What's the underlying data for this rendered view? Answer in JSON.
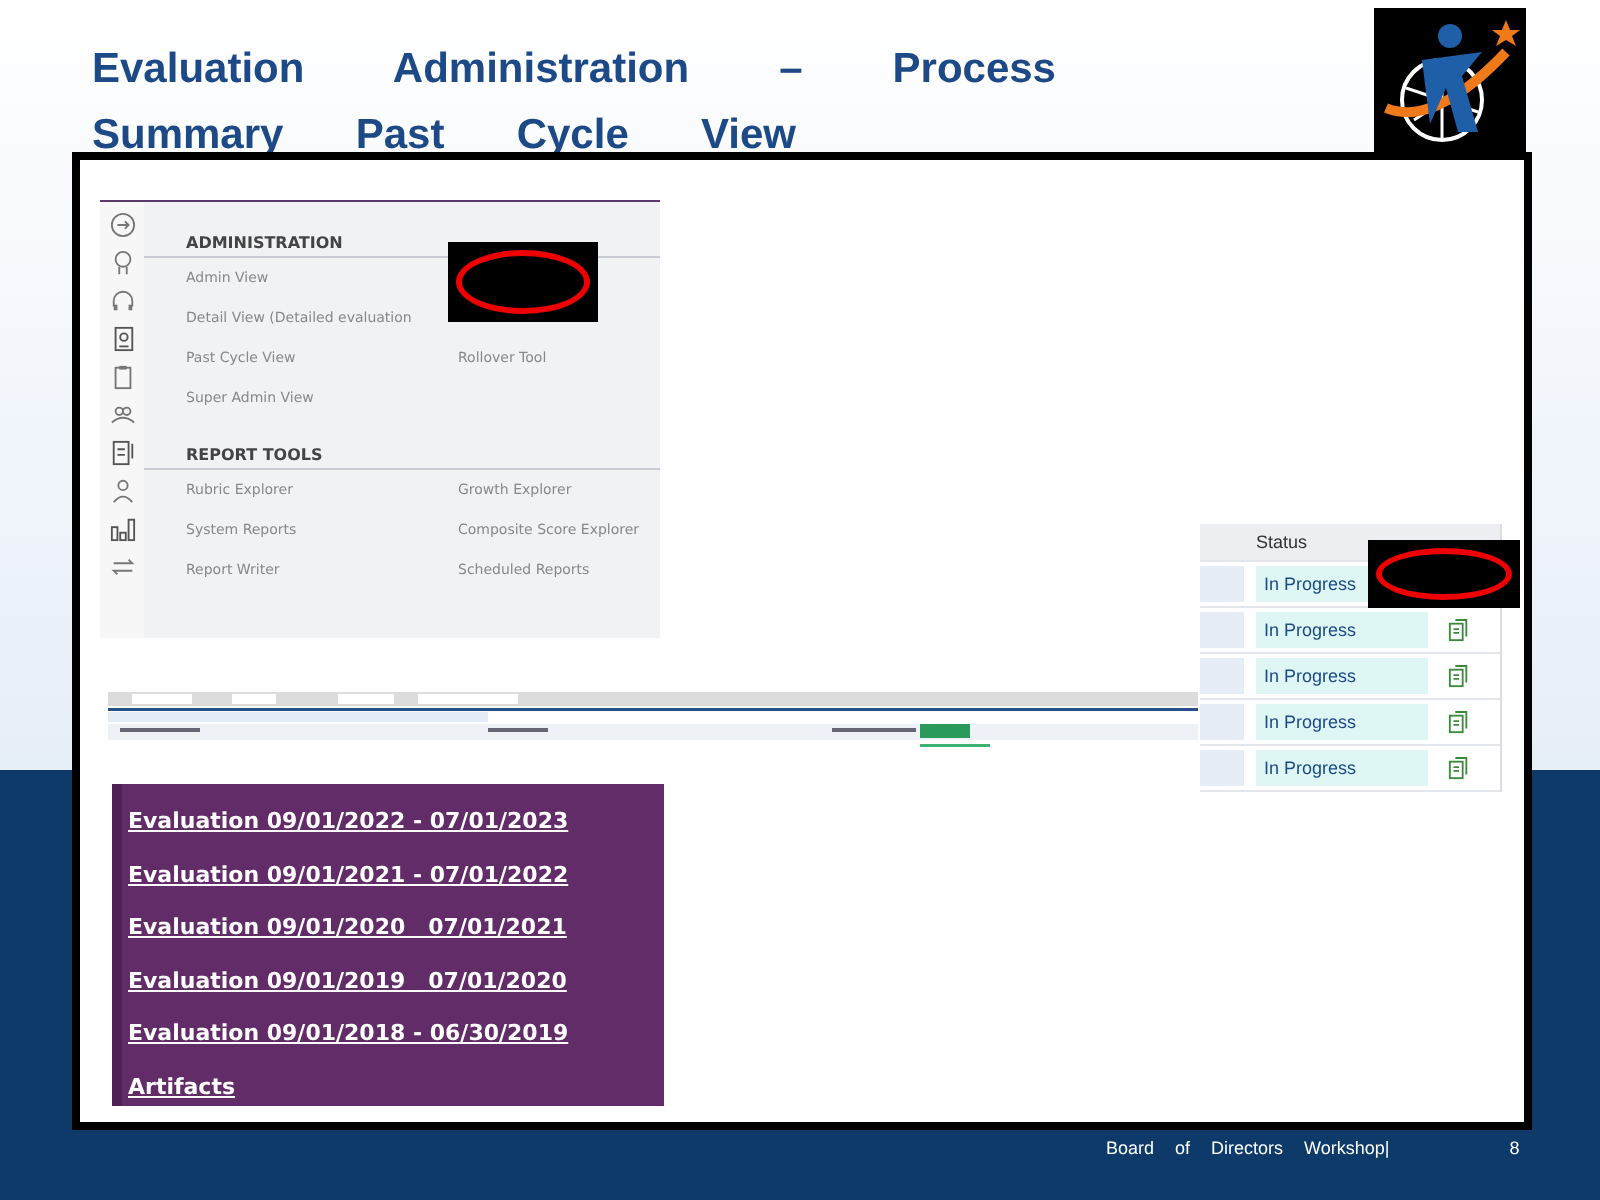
{
  "slide": {
    "title_lines": [
      "Evaluation Administration – Process",
      "Summary Past Cycle View"
    ]
  },
  "admin_menu": {
    "sections": [
      {
        "heading": "ADMINISTRATION",
        "rows": [
          {
            "left": "Admin View"
          },
          {
            "left": "Detail View (Detailed evaluation"
          },
          {
            "left": "Past Cycle View",
            "right": "Rollover Tool"
          },
          {
            "left": "Super Admin View"
          }
        ]
      },
      {
        "heading": "REPORT TOOLS",
        "rows": [
          {
            "left": "Rubric Explorer",
            "right": "Growth Explorer"
          },
          {
            "left": "System Reports",
            "right": "Composite Score Explorer"
          },
          {
            "left": "Report Writer",
            "right": "Scheduled Reports"
          }
        ]
      }
    ]
  },
  "status_table": {
    "header": "Status",
    "rows": [
      {
        "status": "In Progress"
      },
      {
        "status": "In Progress"
      },
      {
        "status": "In Progress"
      },
      {
        "status": "In Progress"
      },
      {
        "status": "In Progress"
      }
    ]
  },
  "evaluation_links": [
    "Evaluation 09/01/2022 - 07/01/2023",
    "Evaluation 09/01/2021 - 07/01/2022",
    "Evaluation 09/01/2020   07/01/2021",
    "Evaluation 09/01/2019   07/01/2020",
    "Evaluation 09/01/2018 - 06/30/2019",
    "Artifacts"
  ],
  "footer": {
    "text": "Board of Directors Workshop|",
    "page": "8"
  }
}
